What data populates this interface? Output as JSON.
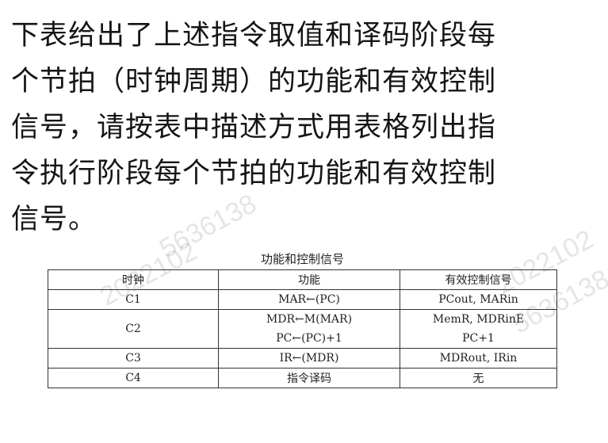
{
  "question": {
    "lines": [
      "下表给出了上述指令取值和译码阶段每",
      "个节拍（时钟周期）的功能和有效控制",
      "信号，请按表中描述方式用表格列出指",
      "令执行阶段每个节拍的功能和有效控制",
      "信号。"
    ]
  },
  "watermark": {
    "lines": [
      "2022102",
      "5636138",
      "2022102",
      "5636138"
    ]
  },
  "table": {
    "caption": "功能和控制信号",
    "headers": [
      "时钟",
      "功能",
      "有效控制信号"
    ],
    "rows": [
      {
        "clock": "C1",
        "function": [
          "MAR←(PC)"
        ],
        "signals": [
          "PCout, MARin"
        ]
      },
      {
        "clock": "C2",
        "function": [
          "MDR←M(MAR)",
          "PC←(PC)+1"
        ],
        "signals": [
          "MemR, MDRinE",
          "PC+1"
        ]
      },
      {
        "clock": "C3",
        "function": [
          "IR←(MDR)"
        ],
        "signals": [
          "MDRout, IRin"
        ]
      },
      {
        "clock": "C4",
        "function": [
          "指令译码"
        ],
        "signals": [
          "无"
        ]
      }
    ]
  }
}
